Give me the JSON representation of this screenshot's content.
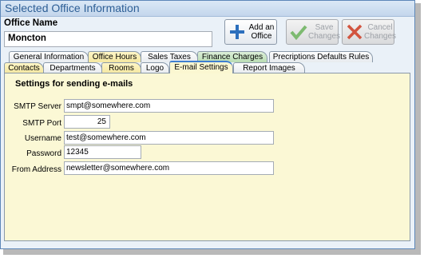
{
  "window": {
    "title": "Selected Office Information"
  },
  "office": {
    "label": "Office Name",
    "value": "Moncton"
  },
  "toolbar": {
    "add_label": "Add an Office",
    "save_label": "Save Changes",
    "cancel_label": "Cancel Changes"
  },
  "tabs_row1": [
    {
      "label": "General Information"
    },
    {
      "label": "Office Hours"
    },
    {
      "label": "Sales Taxes"
    },
    {
      "label": "Finance Charges"
    },
    {
      "label": "Precriptions Defaults Rules"
    }
  ],
  "tabs_row2": [
    {
      "label": "Contacts"
    },
    {
      "label": "Departments"
    },
    {
      "label": "Rooms"
    },
    {
      "label": "Logo"
    },
    {
      "label": "E-mail Settings"
    },
    {
      "label": "Report Images"
    }
  ],
  "active_tab": "E-mail Settings",
  "email": {
    "section_title": "Settings for sending e-mails",
    "smtp_server_label": "SMTP Server",
    "smtp_server": "smpt@somewhere.com",
    "smtp_port_label": "SMTP Port",
    "smtp_port": "25",
    "username_label": "Username",
    "username": "test@somewhere.com",
    "password_label": "Password",
    "password": "12345",
    "from_label": "From Address",
    "from_address": "newsletter@somewhere.com"
  },
  "colors": {
    "title": "#2e5f96",
    "panel": "#fbf8d5",
    "tab_yellow": "#f4e7a0",
    "tab_green": "#b9dcb3",
    "add_icon": "#2c6fbd",
    "save_icon": "#5ea84e",
    "cancel_icon": "#cc3b2a"
  }
}
